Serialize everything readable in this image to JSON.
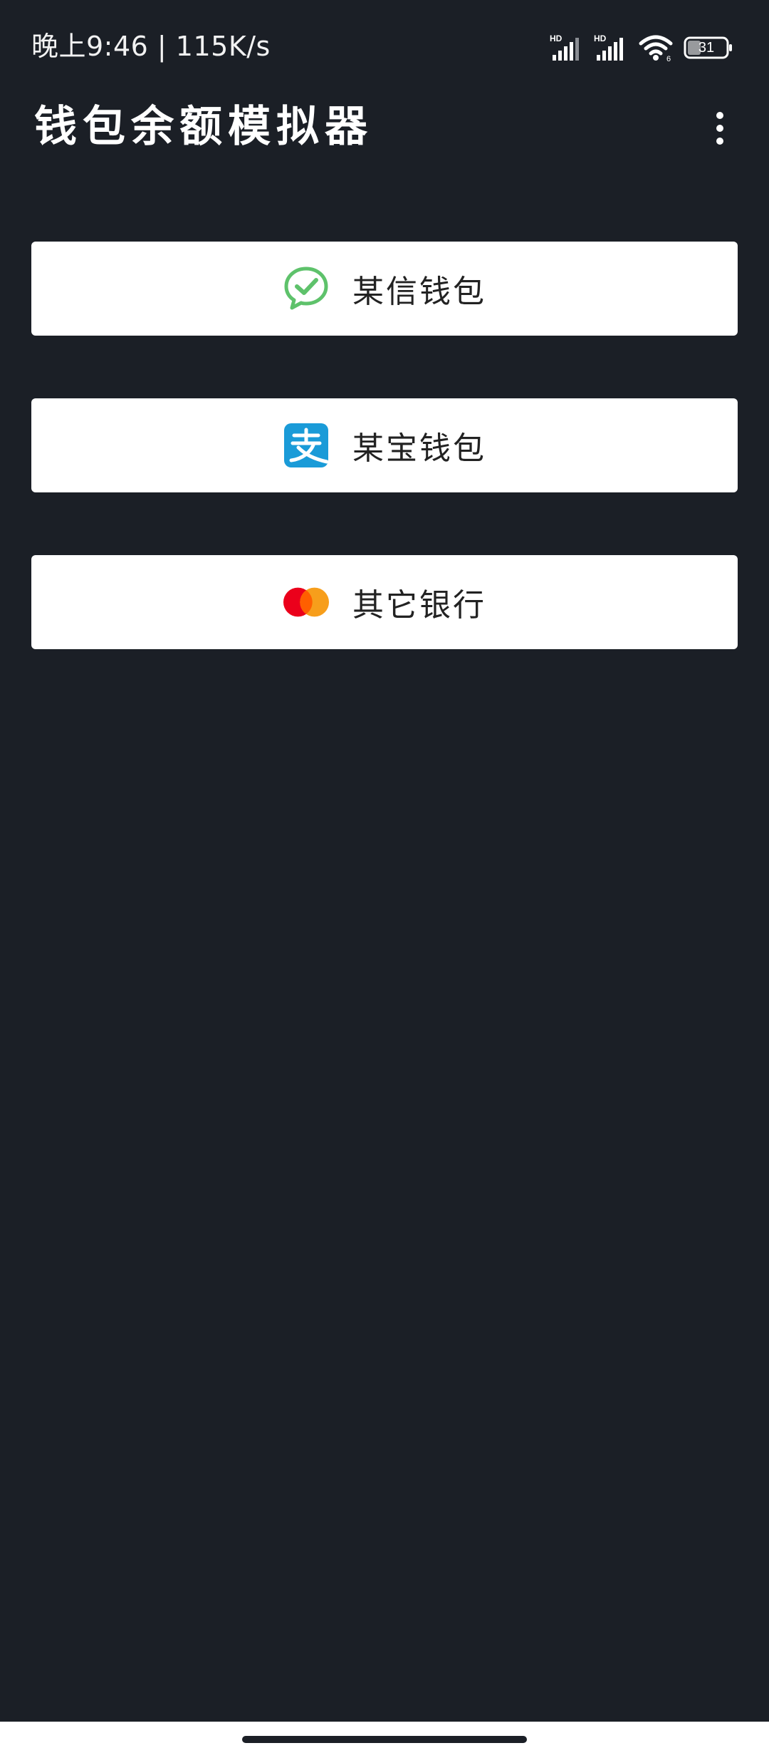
{
  "status_bar": {
    "time_text": "晚上9:46 | 115K/s",
    "battery_level": "31",
    "icons": [
      "hd-signal-icon",
      "hd-signal-icon",
      "wifi-icon",
      "battery-icon"
    ]
  },
  "app_bar": {
    "title": "钱包余额模拟器",
    "menu_icon": "more-vertical-icon"
  },
  "wallets": [
    {
      "label": "某信钱包",
      "icon": "wechat-pay-icon",
      "accent": "#5ec26b"
    },
    {
      "label": "某宝钱包",
      "icon": "alipay-icon",
      "accent": "#1a9bd8"
    },
    {
      "label": "其它银行",
      "icon": "mastercard-icon",
      "accent": "#eb001b"
    }
  ],
  "colors": {
    "background": "#1b1f26",
    "card": "#ffffff",
    "card_text": "#222222"
  }
}
